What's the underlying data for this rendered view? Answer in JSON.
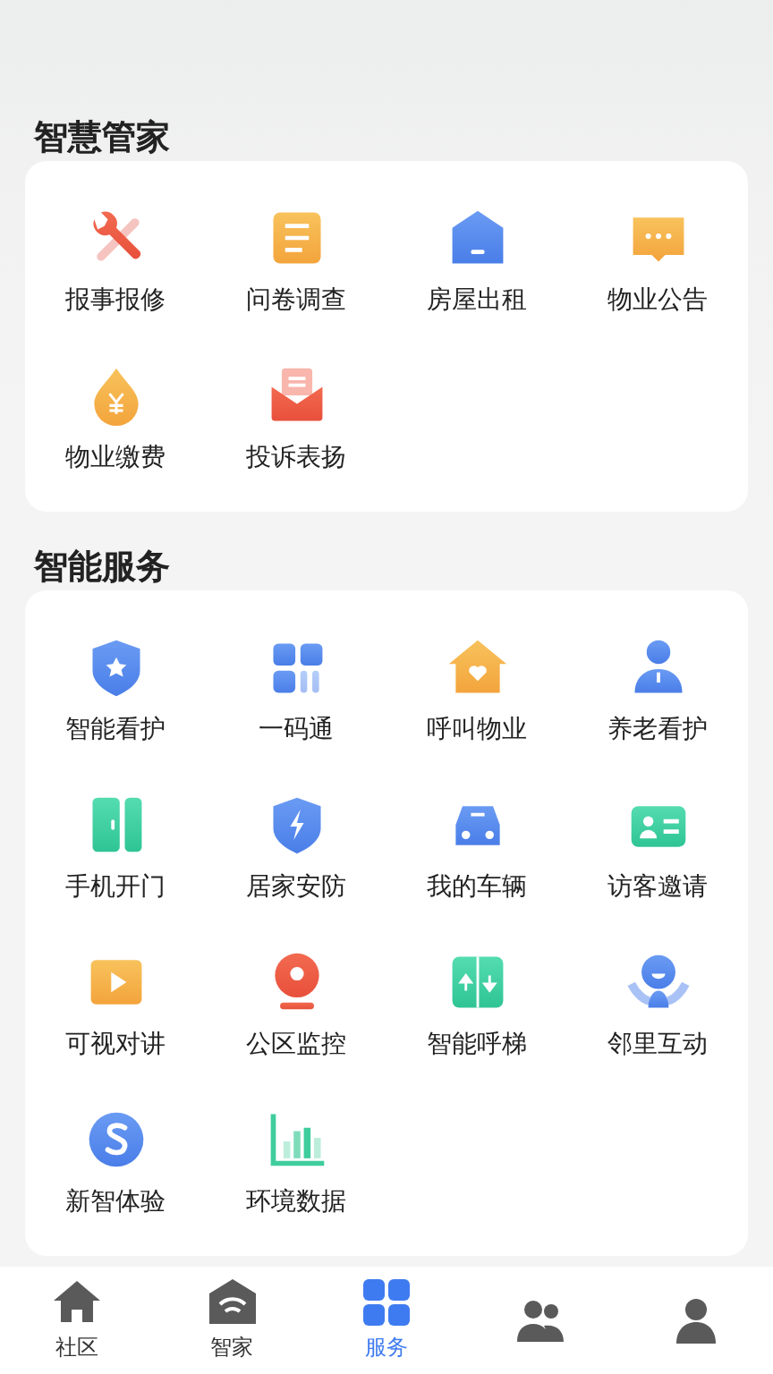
{
  "sections": [
    {
      "title": "智慧管家",
      "items": [
        {
          "label": "报事报修"
        },
        {
          "label": "问卷调查"
        },
        {
          "label": "房屋出租"
        },
        {
          "label": "物业公告"
        },
        {
          "label": "物业缴费"
        },
        {
          "label": "投诉表扬"
        }
      ]
    },
    {
      "title": "智能服务",
      "items": [
        {
          "label": "智能看护"
        },
        {
          "label": "一码通"
        },
        {
          "label": "呼叫物业"
        },
        {
          "label": "养老看护"
        },
        {
          "label": "手机开门"
        },
        {
          "label": "居家安防"
        },
        {
          "label": "我的车辆"
        },
        {
          "label": "访客邀请"
        },
        {
          "label": "可视对讲"
        },
        {
          "label": "公区监控"
        },
        {
          "label": "智能呼梯"
        },
        {
          "label": "邻里互动"
        },
        {
          "label": "新智体验"
        },
        {
          "label": "环境数据"
        }
      ]
    }
  ],
  "tab_bar": [
    {
      "label": "社区",
      "selected": false
    },
    {
      "label": "智家",
      "selected": false
    },
    {
      "label": "服务",
      "selected": true
    },
    {
      "selected": false
    },
    {
      "selected": false
    }
  ]
}
